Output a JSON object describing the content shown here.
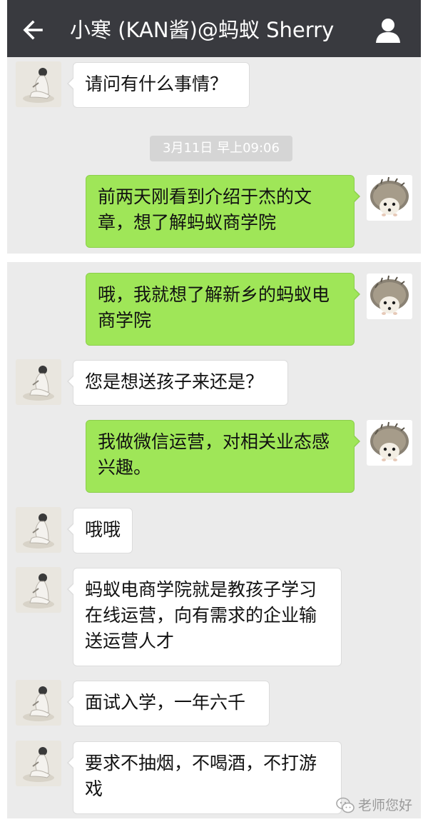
{
  "header": {
    "title": "小寒 (KAN酱)@蚂蚁 Sherry",
    "back_icon": "arrow-left-icon",
    "profile_icon": "person-icon",
    "background_color": "#393a3f"
  },
  "timestamp": "3月11日 早上09:06",
  "messages": [
    {
      "side": "in",
      "text": "请问有什么事情？"
    },
    {
      "side": "out",
      "text": "前两天刚看到介绍于杰的文章，想了解蚂蚁商学院"
    },
    {
      "side": "out",
      "text": "哦，我就想了解新乡的蚂蚁电商学院"
    },
    {
      "side": "in",
      "text": "您是想送孩子来还是？"
    },
    {
      "side": "out",
      "text": "我做微信运营，对相关业态感兴趣。"
    },
    {
      "side": "in",
      "text": "哦哦"
    },
    {
      "side": "in",
      "text": "蚂蚁电商学院就是教孩子学习在线运营，向有需求的企业输送运营人才"
    },
    {
      "side": "in",
      "text": "面试入学，一年六千"
    },
    {
      "side": "in",
      "text": "要求不抽烟，不喝酒，不打游戏"
    }
  ],
  "avatars": {
    "in": "girl-sitting-avatar",
    "out": "hedgehog-avatar"
  },
  "colors": {
    "chat_background": "#ebebeb",
    "outgoing_bubble": "#9fe658",
    "incoming_bubble": "#ffffff"
  },
  "watermark": {
    "text": "老师您好",
    "icon": "wechat-logo-icon"
  }
}
